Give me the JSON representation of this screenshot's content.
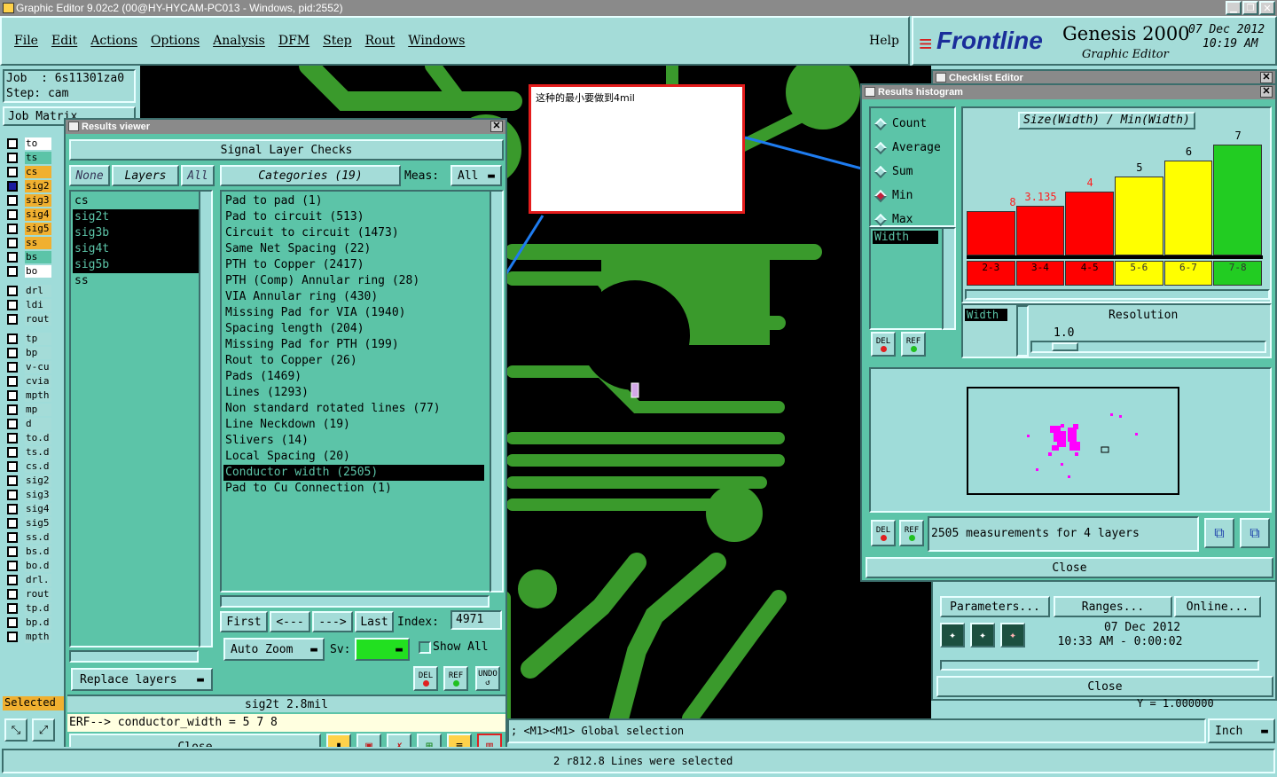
{
  "window": {
    "title": "Graphic Editor 9.02c2 (00@HY-HYCAM-PC013 - Windows, pid:2552)"
  },
  "menu": [
    "File",
    "Edit",
    "Actions",
    "Options",
    "Analysis",
    "DFM",
    "Step",
    "Rout",
    "Windows"
  ],
  "help": "Help",
  "brand": {
    "name": "Frontline",
    "product": "Genesis 2000",
    "subtitle": "Graphic Editor",
    "date": "07 Dec 2012",
    "time": "10:19 AM"
  },
  "job": {
    "job": "Job  : 6s11301za0",
    "step": "Step: cam",
    "matrix": "Job Matrix"
  },
  "layers": [
    {
      "name": "to",
      "color": "#ffffff"
    },
    {
      "name": "ts",
      "color": "#5cc4a8"
    },
    {
      "name": "cs",
      "color": "#f0b030"
    },
    {
      "name": "sig2",
      "color": "#f0b030"
    },
    {
      "name": "sig3",
      "color": "#f0b030"
    },
    {
      "name": "sig4",
      "color": "#f0b030"
    },
    {
      "name": "sig5",
      "color": "#f0b030"
    },
    {
      "name": "ss",
      "color": "#f0b030"
    },
    {
      "name": "bs",
      "color": "#5cc4a8"
    },
    {
      "name": "bo",
      "color": "#ffffff"
    },
    {
      "name": "drl",
      "color": "#a4dcd8"
    },
    {
      "name": "ldi",
      "color": "#a4dcd8"
    },
    {
      "name": "rout",
      "color": "#a4dcd8"
    },
    {
      "name": "tp",
      "color": "#a4dcd8"
    },
    {
      "name": "bp",
      "color": "#a4dcd8"
    },
    {
      "name": "v-cu",
      "color": "#a4dcd8"
    },
    {
      "name": "cvia",
      "color": "#a4dcd8"
    },
    {
      "name": "mpth",
      "color": "#a4dcd8"
    },
    {
      "name": "mp",
      "color": "#a4dcd8"
    },
    {
      "name": "d",
      "color": "#a4dcd8"
    },
    {
      "name": "to.d",
      "color": "#a4dcd8"
    },
    {
      "name": "ts.d",
      "color": "#a4dcd8"
    },
    {
      "name": "cs.d",
      "color": "#a4dcd8"
    },
    {
      "name": "sig2",
      "color": "#a4dcd8"
    },
    {
      "name": "sig3",
      "color": "#a4dcd8"
    },
    {
      "name": "sig4",
      "color": "#a4dcd8"
    },
    {
      "name": "sig5",
      "color": "#a4dcd8"
    },
    {
      "name": "ss.d",
      "color": "#a4dcd8"
    },
    {
      "name": "bs.d",
      "color": "#a4dcd8"
    },
    {
      "name": "bo.d",
      "color": "#a4dcd8"
    },
    {
      "name": "drl.",
      "color": "#a4dcd8"
    },
    {
      "name": "rout",
      "color": "#a4dcd8"
    },
    {
      "name": "tp.d",
      "color": "#a4dcd8"
    },
    {
      "name": "bp.d",
      "color": "#a4dcd8"
    },
    {
      "name": "mpth",
      "color": "#a4dcd8"
    }
  ],
  "selected_label": "Selected",
  "results_viewer": {
    "title": "Results viewer",
    "header": "Signal Layer Checks",
    "none": "None",
    "layers_label": "Layers",
    "all": "All",
    "layer_list": [
      "cs",
      "sig2t",
      "sig3b",
      "sig4t",
      "sig5b",
      "ss"
    ],
    "layer_selected": [
      false,
      true,
      true,
      true,
      true,
      false
    ],
    "categories_label": "Categories (19)",
    "meas_label": "Meas:",
    "meas_value": "All",
    "categories": [
      "Pad to pad (1)",
      "Pad to circuit (513)",
      "Circuit to circuit (1473)",
      "Same Net Spacing (22)",
      "PTH to Copper (2417)",
      "PTH (Comp) Annular ring (28)",
      "VIA Annular ring (430)",
      "Missing Pad for VIA (1940)",
      "Spacing length (204)",
      "Missing Pad for PTH (199)",
      "Rout to Copper (26)",
      "Pads (1469)",
      "Lines (1293)",
      "Non standard rotated lines (77)",
      "Line Neckdown (19)",
      "Slivers (14)",
      "Local Spacing (20)",
      "Conductor width (2505)",
      "Pad to Cu Connection (1)"
    ],
    "selected_category": 17,
    "first": "First",
    "prev": "<---",
    "next": "--->",
    "last": "Last",
    "index_label": "Index:",
    "index_value": "4971",
    "auto_zoom": "Auto Zoom",
    "sv": "Sv:",
    "show_all": "Show All",
    "replace_layers": "Replace layers",
    "del": "DEL",
    "ref": "REF",
    "undo": "UNDO",
    "status": "sig2t 2.8mil",
    "erf": "ERF--> conductor_width = 5 7 8",
    "close": "Close"
  },
  "annotation": {
    "text": "这种的最小要做到4mil"
  },
  "histogram": {
    "title": "Results histogram",
    "checklist_title": "Checklist Editor",
    "modes": [
      "Count",
      "Average",
      "Sum",
      "Min",
      "Max"
    ],
    "mode_selected": 3,
    "attr": "Width",
    "chart_title": "Size(Width) / Min(Width)",
    "resolution_label": "Resolution",
    "resolution_value": "1.0",
    "res_attr": "Width",
    "del": "DEL",
    "ref": "REF",
    "measurements": "2505 measurements for 4 layers",
    "close": "Close"
  },
  "chart_data": {
    "type": "bar",
    "title": "Size(Width) / Min(Width)",
    "categories": [
      "2-3",
      "3-4",
      "4-5",
      "5-6",
      "6-7",
      "7-8"
    ],
    "values": [
      2.8,
      3.135,
      4,
      5,
      6,
      7
    ],
    "value_labels": [
      "8",
      "3.135",
      "4",
      "5",
      "6",
      "7"
    ],
    "colors": [
      "#ff0000",
      "#ff0000",
      "#ff0000",
      "#ffff00",
      "#ffff00",
      "#22cc22"
    ],
    "ylim": [
      0,
      7.6
    ]
  },
  "checklist": {
    "parameters": "Parameters...",
    "ranges": "Ranges...",
    "online": "Online...",
    "date": "07 Dec 2012",
    "timeinfo": "10:33 AM - 0:00:02",
    "close": "Close",
    "y_label": "Y = 1.000000"
  },
  "bottom": {
    "message": "; <M1><M1> Global selection",
    "units": "Inch",
    "status": "2 r812.8 Lines were selected"
  }
}
